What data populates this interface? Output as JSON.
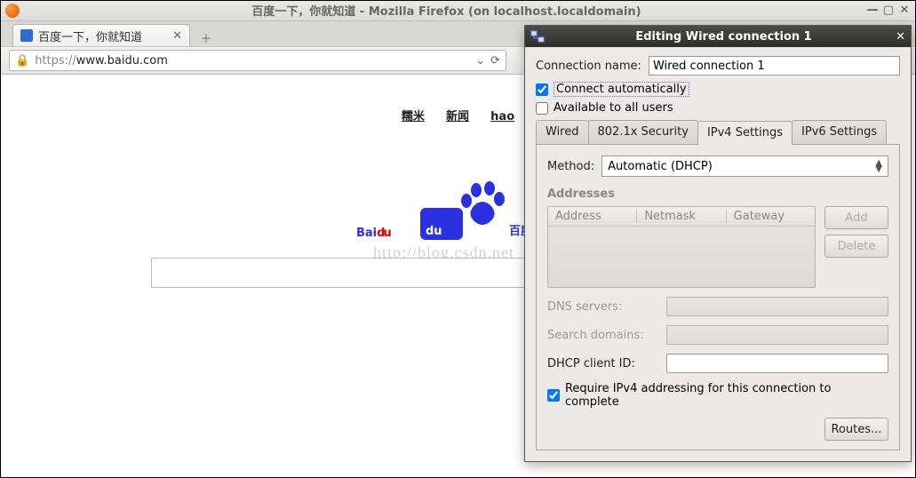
{
  "firefox": {
    "window_title": "百度一下，你就知道 - Mozilla Firefox (on localhost.localdomain)",
    "tab_title": "百度一下，你就知道",
    "url_scheme": "https://",
    "url_host": "www.baidu.com",
    "lock_icon": "lock-icon"
  },
  "page": {
    "top_links": [
      "糯米",
      "新闻",
      "hao"
    ],
    "logo_latin_1": "Bai",
    "logo_latin_2": "du",
    "logo_cn": "百度",
    "watermark": "http://blog.csdn.net"
  },
  "dialog": {
    "title": "Editing Wired connection 1",
    "conn_name_label": "Connection name:",
    "conn_name_value": "Wired connection 1",
    "connect_auto": "Connect automatically",
    "connect_auto_checked": true,
    "avail_all": "Available to all users",
    "avail_all_checked": false,
    "tabs": [
      "Wired",
      "802.1x Security",
      "IPv4 Settings",
      "IPv6 Settings"
    ],
    "active_tab_index": 2,
    "ipv4": {
      "method_label": "Method:",
      "method_value": "Automatic (DHCP)",
      "addresses_label": "Addresses",
      "cols": {
        "address": "Address",
        "netmask": "Netmask",
        "gateway": "Gateway"
      },
      "add_btn": "Add",
      "delete_btn": "Delete",
      "dns_label": "DNS servers:",
      "search_label": "Search domains:",
      "dhcp_id_label": "DHCP client ID:",
      "dhcp_id_value": "",
      "require_ipv4": "Require IPv4 addressing for this connection to complete",
      "require_ipv4_checked": true,
      "routes_btn": "Routes..."
    }
  }
}
